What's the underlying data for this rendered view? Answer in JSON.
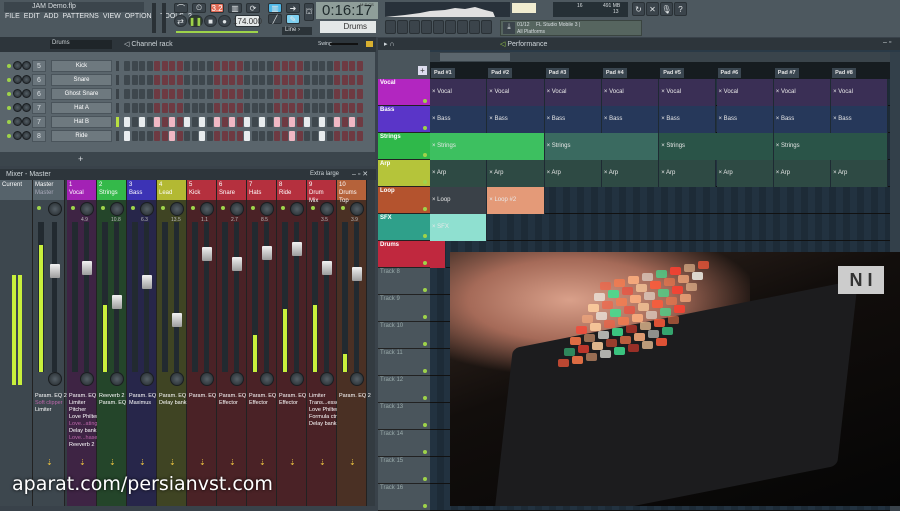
{
  "app": {
    "title": "JAM Demo.flp",
    "menu": [
      "FILE",
      "EDIT",
      "ADD",
      "PATTERNS",
      "VIEW",
      "OPTIONS",
      "TOOLS",
      "?"
    ],
    "tempo": "174.000",
    "time": "0:16:17",
    "time_label": "M:S:CS",
    "snap": "Line",
    "pattern": "Drums",
    "cpu": "16",
    "memory": "491 MB",
    "polyphony": "13",
    "news_counter": "01/12",
    "news_text": "FL Studio Mobile 3 |",
    "news_sub": "All Platforms"
  },
  "channel_rack": {
    "title": "Channel rack",
    "filter": "Drums",
    "swing_label": "Swing",
    "add_label": "+",
    "channels": [
      {
        "num": "5",
        "name": "Kick",
        "steps": []
      },
      {
        "num": "6",
        "name": "Snare",
        "steps": []
      },
      {
        "num": "6",
        "name": "Ghost Snare",
        "steps": []
      },
      {
        "num": "7",
        "name": "Hat A",
        "steps": []
      },
      {
        "num": "7",
        "name": "Hat B",
        "steps": [
          0,
          2,
          4,
          6,
          8,
          10,
          12,
          14,
          16,
          18,
          20,
          22,
          24,
          26,
          28,
          30
        ]
      },
      {
        "num": "8",
        "name": "Ride",
        "steps": [
          0,
          6,
          10,
          16,
          22,
          26
        ]
      }
    ]
  },
  "mixer": {
    "title": "Mixer - Master",
    "size": "Extra large",
    "current": "Current",
    "master": {
      "name": "Master",
      "sub": "Master",
      "fx": [
        "Param. EQ 2",
        "Soft clipper",
        "Limiter"
      ],
      "fader": 0.7,
      "meter": 0.85
    },
    "strips": [
      {
        "num": "1",
        "name": "Vocal",
        "value": "4.9",
        "color": "#a322b5",
        "body": "#3e2444",
        "fader": 0.72,
        "meter": 0,
        "fx": [
          "Param. EQ 2",
          "Limiter",
          "Pitcher",
          "Love Philter",
          "Love...ating",
          "Delay bank",
          "Love...haser",
          "Reeverb 2"
        ]
      },
      {
        "num": "2",
        "name": "Strings",
        "value": "10.8",
        "color": "#34b94a",
        "body": "#24452a",
        "fader": 0.48,
        "meter": 0.45,
        "fx": [
          "Reeverb 2",
          "Param. EQ 2"
        ]
      },
      {
        "num": "3",
        "name": "Bass",
        "value": "6.3",
        "color": "#3c33b5",
        "body": "#27264a",
        "fader": 0.62,
        "meter": 0,
        "fx": [
          "Param. EQ 2",
          "Maximus"
        ]
      },
      {
        "num": "4",
        "name": "Lead",
        "value": "13.5",
        "color": "#b3b933",
        "body": "#3f4423",
        "fader": 0.35,
        "meter": 0,
        "fx": [
          "Param. EQ 2",
          "Delay bank"
        ]
      },
      {
        "num": "5",
        "name": "Kick",
        "value": "1.1",
        "color": "#b5303e",
        "body": "#4a2226",
        "fader": 0.82,
        "meter": 0,
        "fx": [
          "Param. EQ 2"
        ]
      },
      {
        "num": "6",
        "name": "Snare",
        "value": "2.7",
        "color": "#b5303e",
        "body": "#4a2226",
        "fader": 0.75,
        "meter": 0,
        "fx": [
          "Param. EQ 2",
          "Effector"
        ]
      },
      {
        "num": "7",
        "name": "Hats",
        "value": "8.5",
        "color": "#b5303e",
        "body": "#4a2226",
        "fader": 0.83,
        "meter": 0.25,
        "fx": [
          "Param. EQ 2",
          "Effector"
        ]
      },
      {
        "num": "8",
        "name": "Ride",
        "value": "",
        "color": "#b5303e",
        "body": "#4a2226",
        "fader": 0.86,
        "meter": 0.42,
        "fx": [
          "Param. EQ 2",
          "Effector"
        ]
      },
      {
        "num": "9",
        "name": "Drum Mix",
        "value": "3.5",
        "color": "#b5303e",
        "body": "#4a2226",
        "fader": 0.72,
        "meter": 0.45,
        "fx": [
          "Limiter",
          "Trans...essor",
          "Love Philter",
          "Formula ctrl",
          "Delay bank"
        ]
      },
      {
        "num": "10",
        "name": "Drums Top",
        "value": "3.9",
        "color": "#b5623a",
        "body": "#4a3024",
        "fader": 0.68,
        "meter": 0.12,
        "fx": [
          "Param. EQ 2"
        ]
      }
    ]
  },
  "playlist": {
    "title": "Performance",
    "pads": [
      "Pad #1",
      "Pad #2",
      "Pad #3",
      "Pad #4",
      "Pad #5",
      "Pad #6",
      "Pad #7",
      "Pad #8"
    ],
    "tracks": [
      {
        "name": "Vocal",
        "color": "#b226c0",
        "clip_color": "#3a2f55",
        "clips": [
          "Vocal",
          "Vocal",
          "Vocal",
          "Vocal",
          "Vocal",
          "Vocal",
          "Vocal",
          "Vocal"
        ]
      },
      {
        "name": "Bass",
        "color": "#5a35c8",
        "clip_color": "#26385a",
        "clips": [
          "Bass",
          "Bass",
          "Bass",
          "Bass",
          "Bass",
          "Bass",
          "Bass",
          "Bass"
        ]
      },
      {
        "name": "Strings",
        "color": "#2fb84a",
        "clip_color": "#275245",
        "clips": [
          "Strings",
          "",
          "Strings",
          "",
          "Strings",
          "",
          "Strings",
          ""
        ]
      },
      {
        "name": "Arp",
        "color": "#b5c43a",
        "clip_color": "#2e4a44",
        "clips": [
          "Arp",
          "Arp",
          "Arp",
          "Arp",
          "Arp",
          "Arp",
          "Arp",
          "Arp"
        ]
      },
      {
        "name": "Loop",
        "color": "#b4532e",
        "clip_color": "#3a4148",
        "clips": [
          "Loop",
          "Loop #2",
          "",
          "",
          "",
          "",
          "",
          ""
        ]
      },
      {
        "name": "SFX",
        "color": "#2fa08a",
        "clip_color": "#8fe0d0",
        "clips": [
          "SFX",
          "",
          "",
          "",
          "",
          "",
          "",
          ""
        ]
      },
      {
        "name": "Drums",
        "color": "#c0283e",
        "clip_color": "#c0283e",
        "clips": [
          "",
          "",
          "",
          "",
          "",
          "",
          "",
          ""
        ]
      },
      {
        "name": "Track 8"
      },
      {
        "name": "Track 9"
      },
      {
        "name": "Track 10"
      },
      {
        "name": "Track 11"
      },
      {
        "name": "Track 12"
      },
      {
        "name": "Track 13"
      },
      {
        "name": "Track 14"
      },
      {
        "name": "Track 15"
      },
      {
        "name": "Track 16"
      }
    ]
  },
  "overlay": {
    "logo": "NI"
  },
  "watermark": "aparat.com/persianvst.com"
}
